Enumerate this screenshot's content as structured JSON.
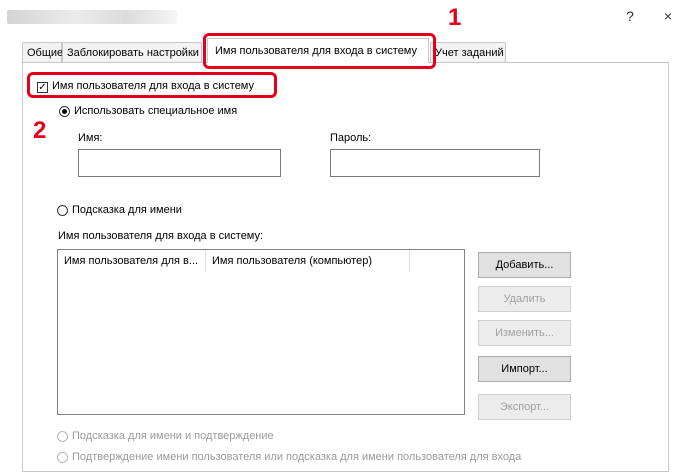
{
  "window": {
    "help_glyph": "?",
    "close_glyph": "×"
  },
  "tabs": [
    {
      "label": "Общие"
    },
    {
      "label": "Заблокировать настройки"
    },
    {
      "label": "Имя пользователя для входа в систему"
    },
    {
      "label": "Учет заданий"
    }
  ],
  "callouts": {
    "step1": "1",
    "step2": "2"
  },
  "login": {
    "enable_label": "Имя пользователя для входа в систему",
    "enable_checked": true,
    "use_custom_name_label": "Использовать специальное имя",
    "name_label": "Имя:",
    "name_value": "",
    "password_label": "Пароль:",
    "password_value": "",
    "prompt_label": "Подсказка для имени",
    "list_label": "Имя пользователя для входа в систему:",
    "columns": [
      "Имя пользователя для в...",
      "Имя пользователя (компьютер)"
    ],
    "rows": [],
    "prompt_confirm_label": "Подсказка для имени и подтверждение",
    "confirm_or_prompt_label": "Подтверждение имени пользователя или подсказка для имени пользователя для входа"
  },
  "buttons": {
    "add": "Добавить...",
    "delete": "Удалить",
    "edit": "Изменить...",
    "import": "Импорт...",
    "export": "Экспорт..."
  },
  "colors": {
    "callout": "#e3001b"
  }
}
